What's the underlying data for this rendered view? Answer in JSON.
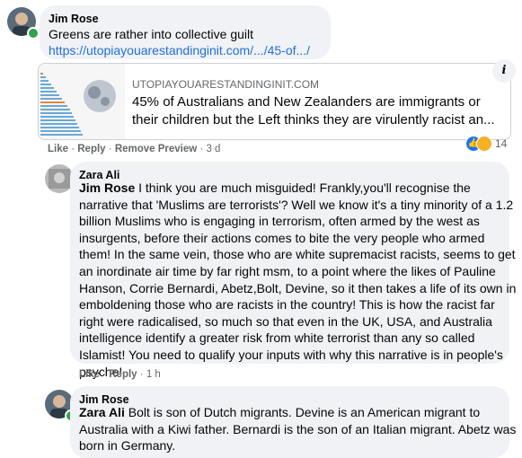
{
  "comments": [
    {
      "author": "Jim Rose",
      "text": "Greens are rather into collective guilt",
      "link": "https://utopiayouarestandinginit.com/.../45-of.../",
      "preview": {
        "domain": "UTOPIAYOUARESTANDINGINIT.COM",
        "title_line1": "45% of Australians and New Zealanders are immigrants or",
        "title_line2": "their children but the Left thinks they are virulently racist an..."
      },
      "actions": {
        "like": "Like",
        "reply": "Reply",
        "remove": "Remove Preview",
        "time": "3 d"
      },
      "reactions": {
        "count": "14"
      }
    },
    {
      "author": "Zara Ali",
      "mention": "Jim Rose",
      "lines": [
        " I think you are much misguided! Frankly,you'll recognise the",
        "narrative that 'Muslims are terrorists'? Well we know it's a tiny minority of a 1.2",
        "billion Muslims who is engaging in terrorism, often armed by the west as",
        "insurgents, before their actions comes to bite the very people who armed",
        "them! In the same vein, those who are white supremacist racists, seems to get",
        "an inordinate air time by far right msm, to a point where the likes of Pauline",
        "Hanson, Corrie Bernardi, Abetz,Bolt, Devine, so it then takes a life of its own in",
        "emboldening those who are racists in the country! This is how the racist far",
        "right were radicalised, so much so that even in the UK, USA, and Australia",
        "intelligence identify a greater risk from white terrorist than any so called",
        "Islamist! You need to qualify your inputs with why this narrative is in people's",
        "psyche!"
      ],
      "actions": {
        "like": "Like",
        "reply": "Reply",
        "time": "1 h"
      }
    },
    {
      "author": "Jim Rose",
      "mention": "Zara Ali",
      "lines": [
        " Bolt is son of Dutch migrants. Devine is an American migrant to",
        "Australia with a Kiwi father. Bernardi is the son of an Italian migrant. Abetz was",
        "born in Germany."
      ]
    }
  ]
}
